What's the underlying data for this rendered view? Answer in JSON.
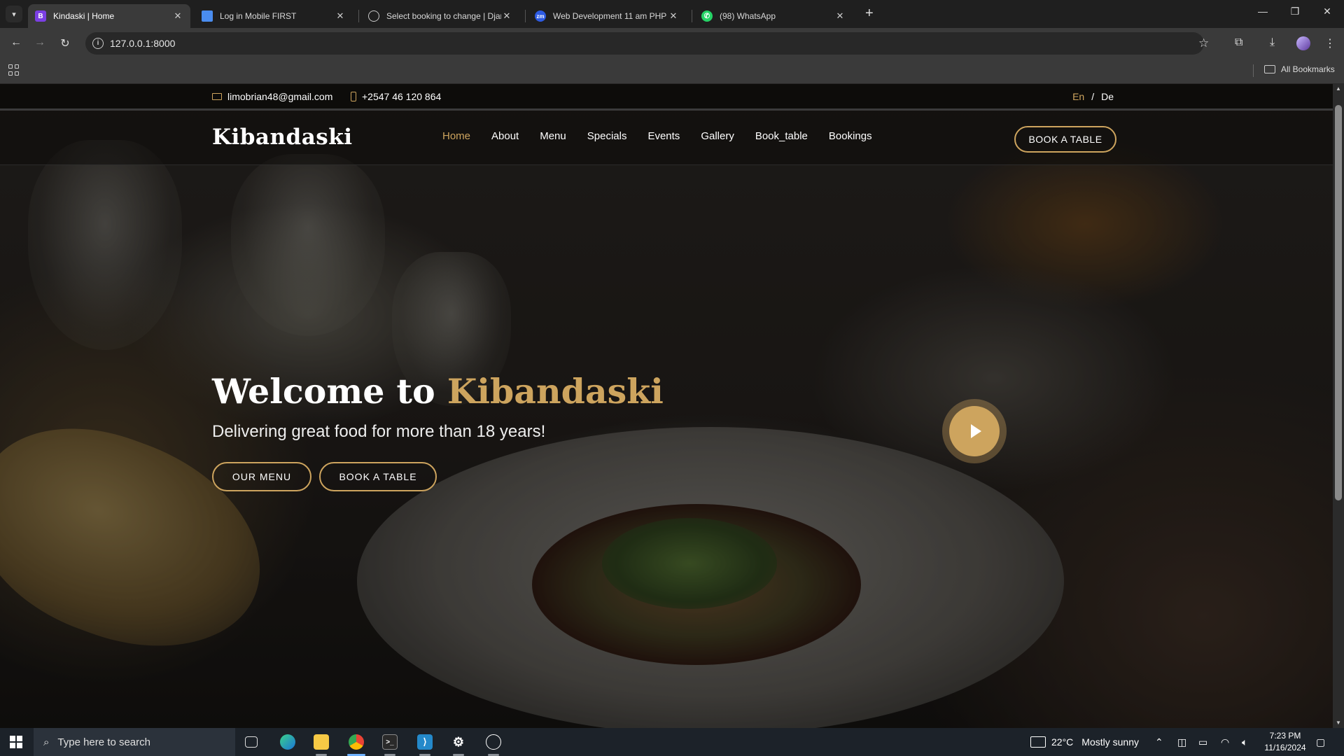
{
  "browser": {
    "tabs": [
      {
        "title": "Kindaski | Home",
        "icon": "B",
        "icon_color": "#7b3fe4",
        "active": true
      },
      {
        "title": "Log in Mobile FIRST",
        "icon": "page-icon",
        "icon_color": "#4a8df0",
        "active": false
      },
      {
        "title": "Select booking to change | Djan",
        "icon": "globe-icon",
        "icon_color": "#c8c8c8",
        "active": false
      },
      {
        "title": "Web Development 11 am PHP -",
        "icon": "zm",
        "icon_color": "#2d5be3",
        "active": false
      },
      {
        "title": "(98) WhatsApp",
        "icon": "whatsapp-icon",
        "icon_color": "#25d366",
        "active": false
      }
    ],
    "url": "127.0.0.1:8000",
    "bookmarks_label": "All Bookmarks"
  },
  "site": {
    "email": "limobrian48@gmail.com",
    "phone": "+2547 46 120 864",
    "lang_en": "En",
    "lang_sep": "/",
    "lang_de": "De",
    "logo": "Kibandaski",
    "nav": [
      "Home",
      "About",
      "Menu",
      "Specials",
      "Events",
      "Gallery",
      "Book_table",
      "Bookings"
    ],
    "nav_active": "Home",
    "header_cta": "BOOK A TABLE",
    "hero_title_prefix": "Welcome to ",
    "hero_title_accent": "Kibandaski",
    "hero_subtitle": "Delivering great food for more than 18 years!",
    "btn_menu": "OUR MENU",
    "btn_book": "BOOK A TABLE",
    "accent_color": "#cda45e"
  },
  "taskbar": {
    "search_placeholder": "Type here to search",
    "weather_temp": "22°C",
    "weather_text": "Mostly sunny",
    "time": "7:23 PM",
    "date": "11/16/2024"
  }
}
